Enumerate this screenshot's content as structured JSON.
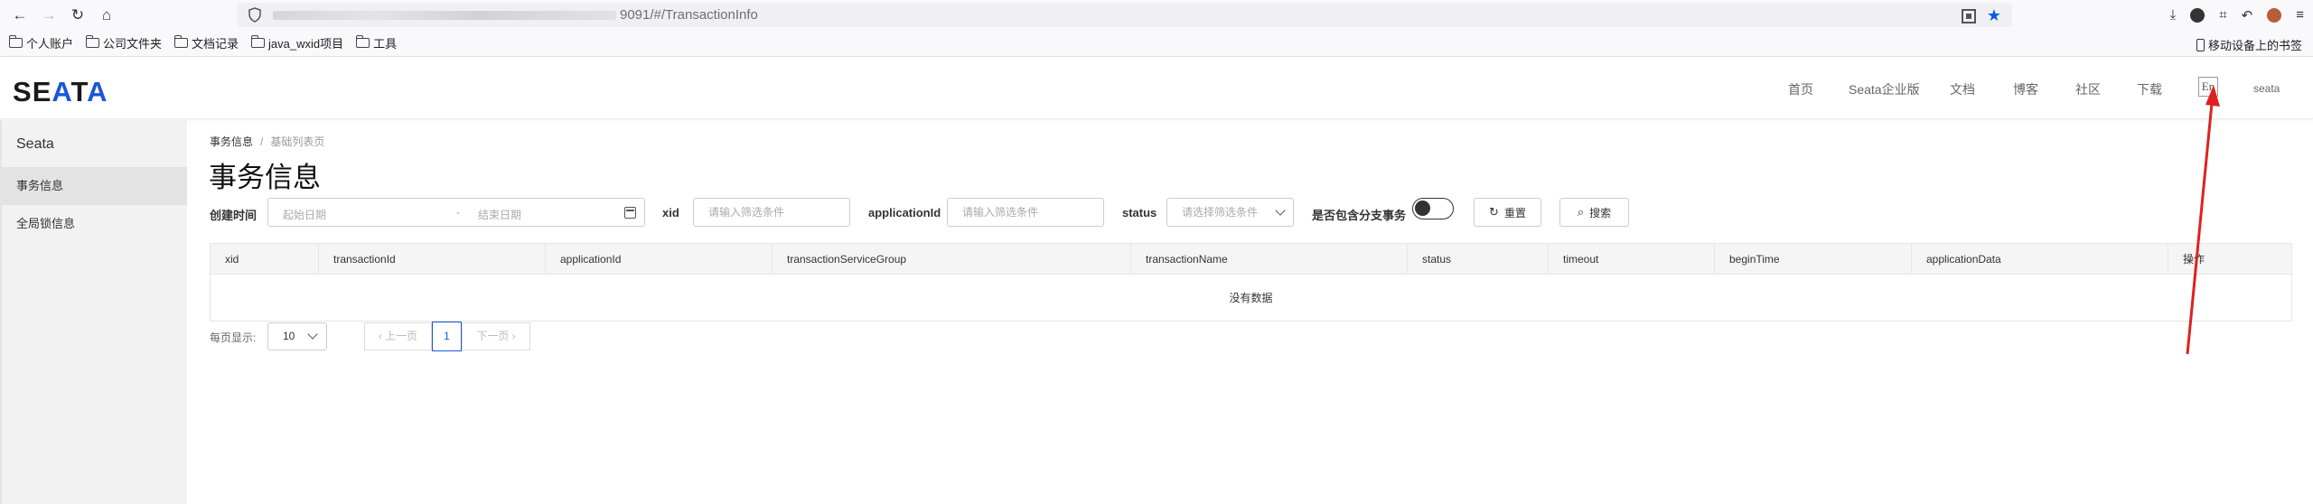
{
  "browser": {
    "url_visible": "9091/#/TransactionInfo",
    "bookmarks": [
      "个人账户",
      "公司文件夹",
      "文档记录",
      "java_wxid项目",
      "工具"
    ],
    "bookmarks_mobile": "移动设备上的书签"
  },
  "header": {
    "logo": "SEATA",
    "nav": [
      "首页",
      "Seata企业版",
      "文档",
      "博客",
      "社区",
      "下载"
    ],
    "lang_toggle": "En",
    "user": "seata"
  },
  "sidebar": {
    "title": "Seata",
    "items": [
      {
        "label": "事务信息",
        "active": true
      },
      {
        "label": "全局锁信息",
        "active": false
      }
    ]
  },
  "breadcrumb": [
    "事务信息",
    "基础列表页"
  ],
  "page_title": "事务信息",
  "filters": {
    "created_time_label": "创建时间",
    "start_date_placeholder": "起始日期",
    "range_separator": "-",
    "end_date_placeholder": "结束日期",
    "xid_label": "xid",
    "xid_placeholder": "请输入筛选条件",
    "application_label": "applicationId",
    "application_placeholder": "请输入筛选条件",
    "status_label": "status",
    "status_placeholder": "请选择筛选条件",
    "branch_label": "是否包含分支事务",
    "branch_toggle_on": false,
    "reset_label": "重置",
    "search_label": "搜索"
  },
  "table": {
    "columns": [
      "xid",
      "transactionId",
      "applicationId",
      "transactionServiceGroup",
      "transactionName",
      "status",
      "timeout",
      "beginTime",
      "applicationData",
      "操作"
    ],
    "empty_text": "没有数据"
  },
  "pagination": {
    "per_page_label": "每页显示:",
    "page_size": "10",
    "prev_label": "上一页",
    "current_page": "1",
    "next_label": "下一页"
  },
  "colors": {
    "accent": "#1a56db",
    "annotation_arrow": "#e02020"
  }
}
